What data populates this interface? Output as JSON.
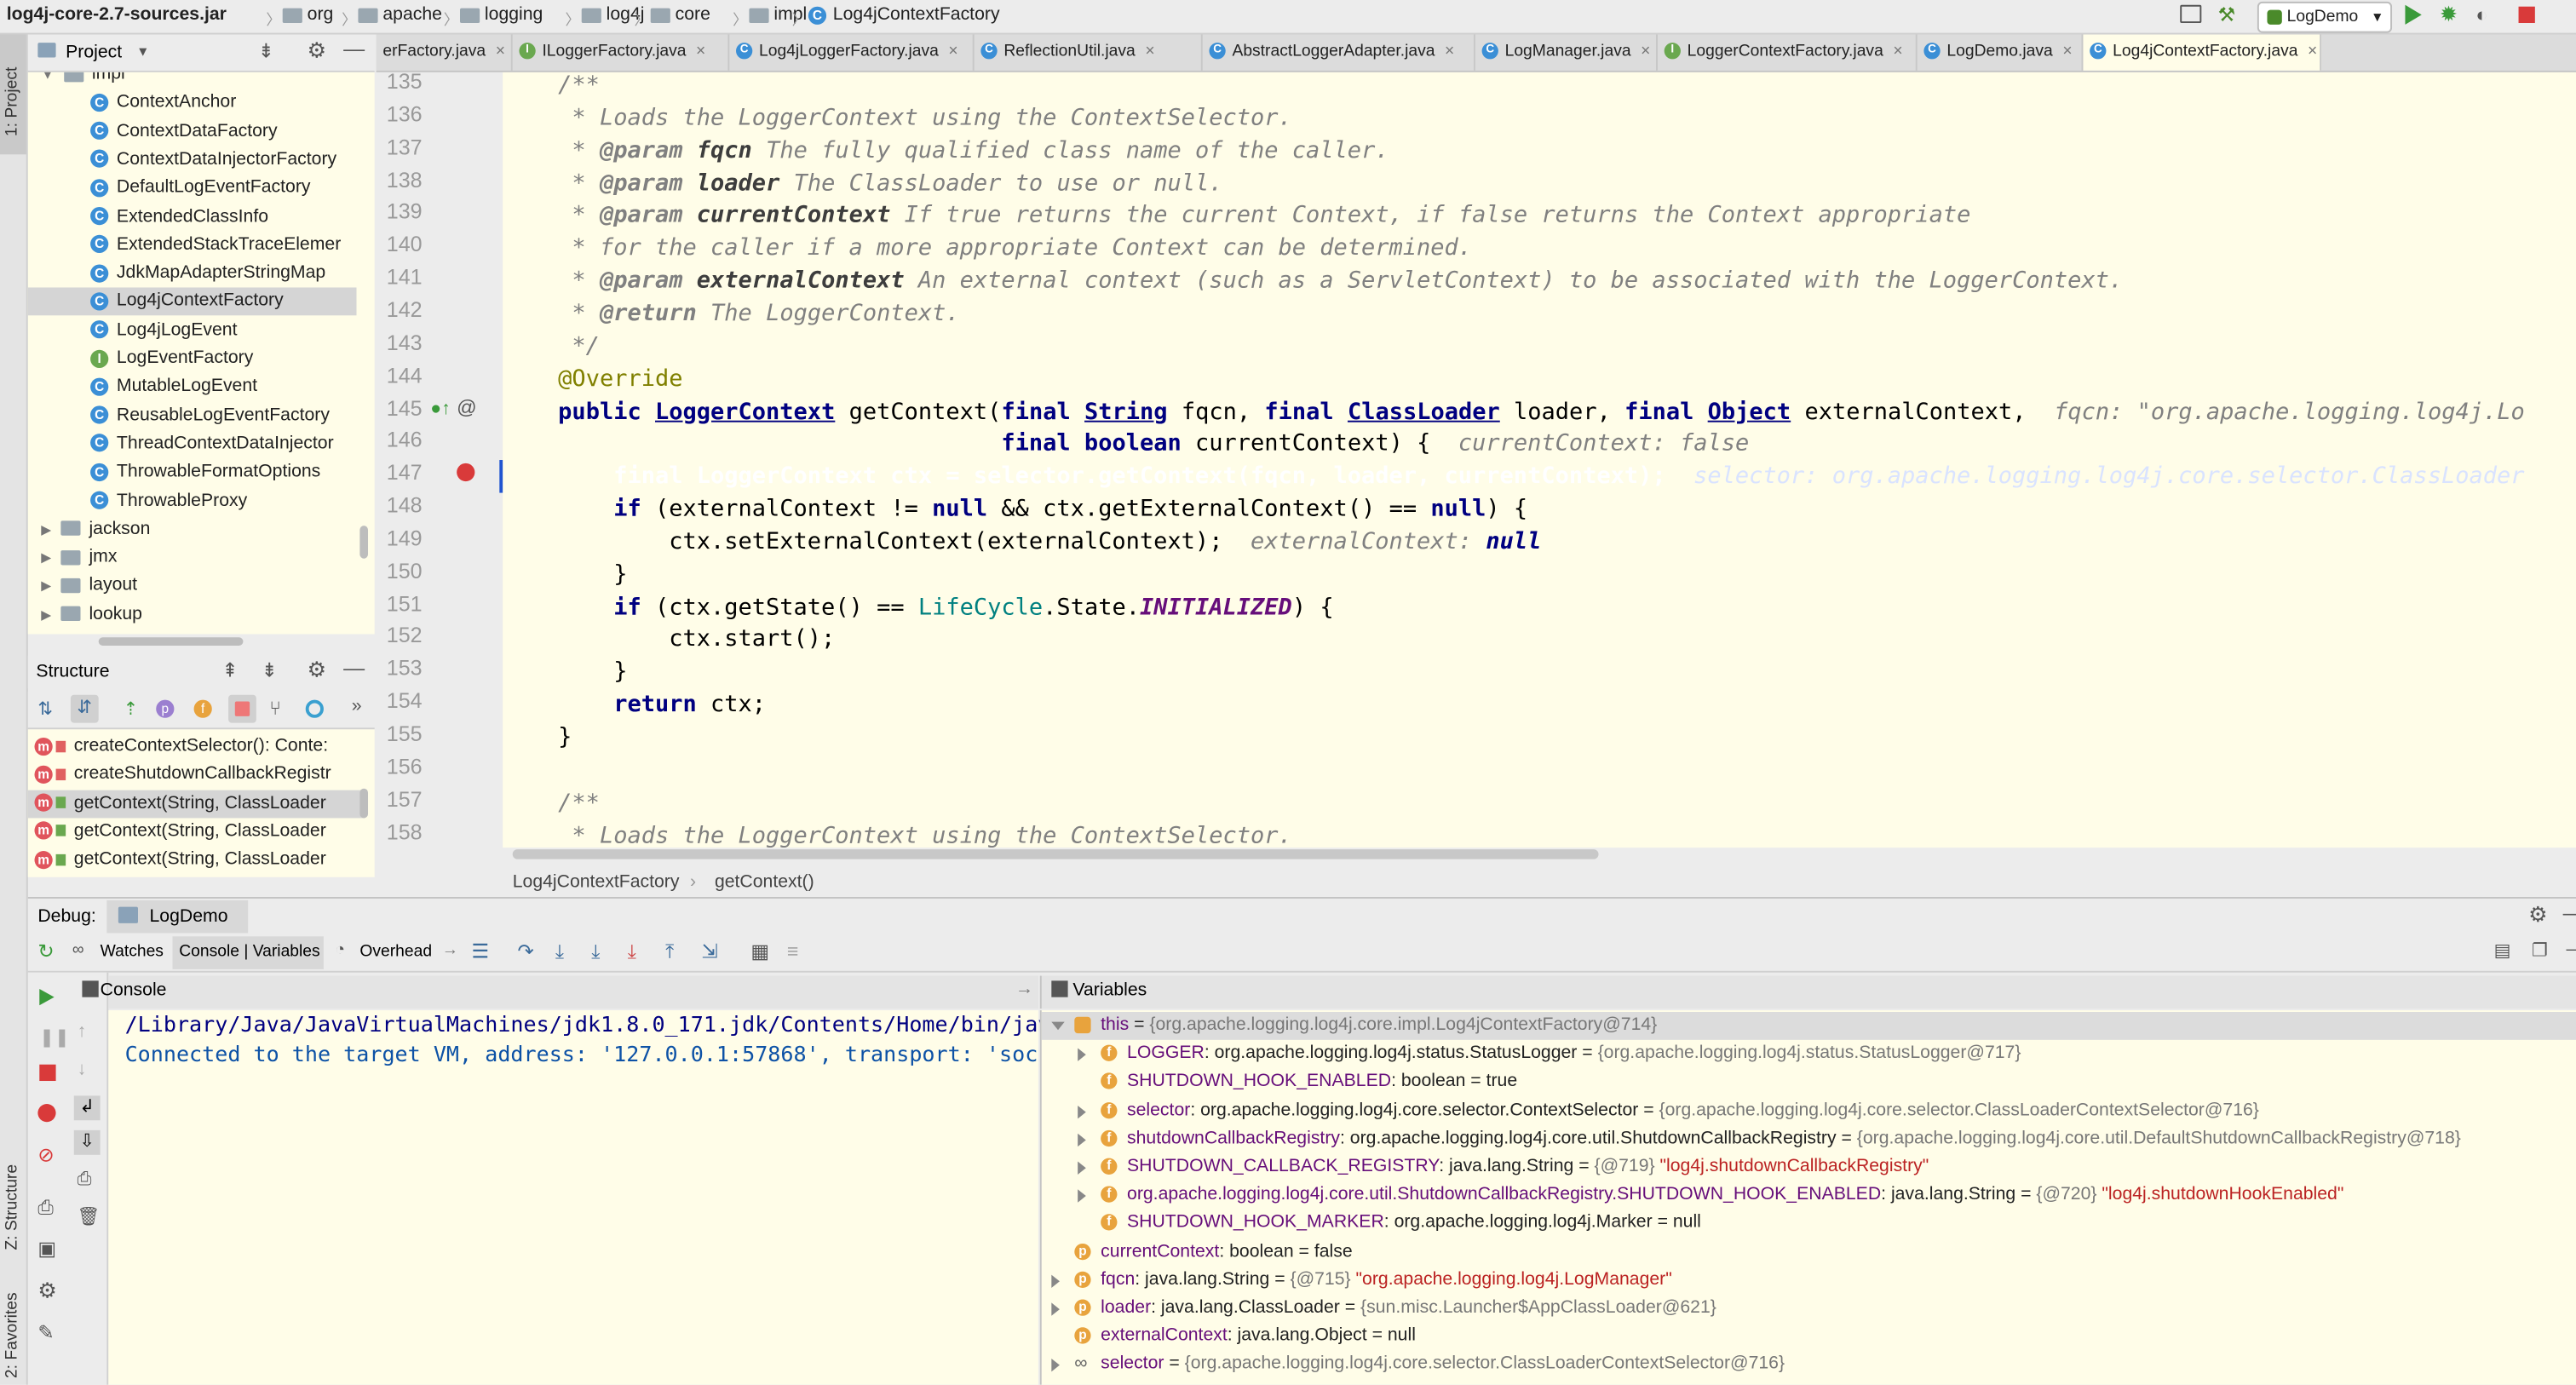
{
  "breadcrumb": [
    "log4j-core-2.7-sources.jar",
    "org",
    "apache",
    "logging",
    "log4j",
    "core",
    "impl",
    "Log4jContextFactory"
  ],
  "run_config": "LogDemo",
  "project_panel": {
    "title": "Project",
    "tree": [
      {
        "label": "impl",
        "kind": "folder",
        "indent": 1
      },
      {
        "label": "ContextAnchor",
        "kind": "class"
      },
      {
        "label": "ContextDataFactory",
        "kind": "class"
      },
      {
        "label": "ContextDataInjectorFactory",
        "kind": "class"
      },
      {
        "label": "DefaultLogEventFactory",
        "kind": "class"
      },
      {
        "label": "ExtendedClassInfo",
        "kind": "class"
      },
      {
        "label": "ExtendedStackTraceElemer",
        "kind": "class"
      },
      {
        "label": "JdkMapAdapterStringMap",
        "kind": "class"
      },
      {
        "label": "Log4jContextFactory",
        "kind": "class",
        "selected": true
      },
      {
        "label": "Log4jLogEvent",
        "kind": "class"
      },
      {
        "label": "LogEventFactory",
        "kind": "interface"
      },
      {
        "label": "MutableLogEvent",
        "kind": "class"
      },
      {
        "label": "ReusableLogEventFactory",
        "kind": "class"
      },
      {
        "label": "ThreadContextDataInjector",
        "kind": "class"
      },
      {
        "label": "ThrowableFormatOptions",
        "kind": "class"
      },
      {
        "label": "ThrowableProxy",
        "kind": "class"
      },
      {
        "label": "jackson",
        "kind": "package"
      },
      {
        "label": "jmx",
        "kind": "package"
      },
      {
        "label": "layout",
        "kind": "package"
      },
      {
        "label": "lookup",
        "kind": "package"
      }
    ]
  },
  "structure_panel": {
    "title": "Structure",
    "items": [
      {
        "label": "createContextSelector(): Conte:",
        "selected": false
      },
      {
        "label": "createShutdownCallbackRegistr",
        "selected": false
      },
      {
        "label": "getContext(String, ClassLoader",
        "selected": true
      },
      {
        "label": "getContext(String, ClassLoader",
        "selected": false
      },
      {
        "label": "getContext(String, ClassLoader",
        "selected": false
      }
    ]
  },
  "tabs": [
    {
      "label": "erFactory.java",
      "kind": "class"
    },
    {
      "label": "ILoggerFactory.java",
      "kind": "interface"
    },
    {
      "label": "Log4jLoggerFactory.java",
      "kind": "class"
    },
    {
      "label": "ReflectionUtil.java",
      "kind": "class"
    },
    {
      "label": "AbstractLoggerAdapter.java",
      "kind": "class"
    },
    {
      "label": "LogManager.java",
      "kind": "class"
    },
    {
      "label": "LoggerContextFactory.java",
      "kind": "interface"
    },
    {
      "label": "LogDemo.java",
      "kind": "class"
    },
    {
      "label": "Log4jContextFactory.java",
      "kind": "class",
      "active": true
    }
  ],
  "line_numbers": [
    "135",
    "136",
    "137",
    "138",
    "139",
    "140",
    "141",
    "142",
    "143",
    "144",
    "145",
    "146",
    "147",
    "148",
    "149",
    "150",
    "151",
    "152",
    "153",
    "154",
    "155",
    "156",
    "157",
    "158"
  ],
  "code_lines": [
    "    /**",
    "     * Loads the LoggerContext using the ContextSelector.",
    "     * @param fqcn The fully qualified class name of the caller.",
    "     * @param loader The ClassLoader to use or null.",
    "     * @param currentContext If true returns the current Context, if false returns the Context appropriate",
    "     * for the caller if a more appropriate Context can be determined.",
    "     * @param externalContext An external context (such as a ServletContext) to be associated with the LoggerContext.",
    "     * @return The LoggerContext.",
    "     */",
    "    @Override",
    "    public LoggerContext getContext(final String fqcn, final ClassLoader loader, final Object externalContext,  fqcn: \"org.apache.logging.log4j.Lo",
    "                                    final boolean currentContext) {  currentContext: false",
    "        final LoggerContext ctx = selector.getContext(fqcn, loader, currentContext);  selector: org.apache.logging.log4j.core.selector.ClassLoader",
    "        if (externalContext != null && ctx.getExternalContext() == null) {",
    "            ctx.setExternalContext(externalContext);  externalContext: null",
    "        }",
    "        if (ctx.getState() == LifeCycle.State.INITIALIZED) {",
    "            ctx.start();",
    "        }",
    "        return ctx;",
    "    }",
    "",
    "    /**",
    "     * Loads the LoggerContext using the ContextSelector."
  ],
  "editor_breadcrumb": [
    "Log4jContextFactory",
    "getContext()"
  ],
  "debug": {
    "label": "Debug:",
    "session": "LogDemo",
    "toolbar": {
      "watches": "Watches",
      "console_vars": "Console | Variables",
      "overhead": "Overhead"
    },
    "console_title": "Console",
    "console_lines": [
      "/Library/Java/JavaVirtualMachines/jdk1.8.0_171.jdk/Contents/Home/bin/java ...",
      "Connected to the target VM, address: '127.0.0.1:57868', transport: 'socket'"
    ],
    "variables_title": "Variables",
    "variables": [
      {
        "indent": 0,
        "expand": "open",
        "badge": "this",
        "name": "this",
        "type": "",
        "value": "{org.apache.logging.log4j.core.impl.Log4jContextFactory@714}",
        "str": ""
      },
      {
        "indent": 1,
        "expand": "closed",
        "badge": "f",
        "name": "LOGGER",
        "type": ": org.apache.logging.log4j.status.StatusLogger ",
        "value": "{org.apache.logging.log4j.status.StatusLogger@717}",
        "str": ""
      },
      {
        "indent": 1,
        "expand": "none",
        "badge": "f",
        "name": "SHUTDOWN_HOOK_ENABLED",
        "type": ": boolean ",
        "value": "true",
        "str": "",
        "plain": true
      },
      {
        "indent": 1,
        "expand": "closed",
        "badge": "f",
        "name": "selector",
        "type": ": org.apache.logging.log4j.core.selector.ContextSelector ",
        "value": "{org.apache.logging.log4j.core.selector.ClassLoaderContextSelector@716}",
        "str": ""
      },
      {
        "indent": 1,
        "expand": "closed",
        "badge": "f",
        "name": "shutdownCallbackRegistry",
        "type": ": org.apache.logging.log4j.core.util.ShutdownCallbackRegistry ",
        "value": "{org.apache.logging.log4j.core.util.DefaultShutdownCallbackRegistry@718}",
        "str": ""
      },
      {
        "indent": 1,
        "expand": "closed",
        "badge": "f",
        "name": "SHUTDOWN_CALLBACK_REGISTRY",
        "type": ": java.lang.String ",
        "value": "{@719} ",
        "str": "\"log4j.shutdownCallbackRegistry\""
      },
      {
        "indent": 1,
        "expand": "closed",
        "badge": "f",
        "name": "org.apache.logging.log4j.core.util.ShutdownCallbackRegistry.SHUTDOWN_HOOK_ENABLED",
        "type": ": java.lang.String ",
        "value": "{@720} ",
        "str": "\"log4j.shutdownHookEnabled\""
      },
      {
        "indent": 1,
        "expand": "none",
        "badge": "f",
        "name": "SHUTDOWN_HOOK_MARKER",
        "type": ": org.apache.logging.log4j.Marker ",
        "value": "null",
        "str": "",
        "plain": true
      },
      {
        "indent": 0,
        "expand": "none",
        "badge": "p",
        "name": "currentContext",
        "type": ": boolean ",
        "value": "false",
        "str": "",
        "plain": true
      },
      {
        "indent": 0,
        "expand": "closed",
        "badge": "p",
        "name": "fqcn",
        "type": ": java.lang.String ",
        "value": "{@715} ",
        "str": "\"org.apache.logging.log4j.LogManager\""
      },
      {
        "indent": 0,
        "expand": "closed",
        "badge": "p",
        "name": "loader",
        "type": ": java.lang.ClassLoader ",
        "value": "{sun.misc.Launcher$AppClassLoader@621}",
        "str": ""
      },
      {
        "indent": 0,
        "expand": "none",
        "badge": "p",
        "name": "externalContext",
        "type": ": java.lang.Object ",
        "value": "null",
        "str": "",
        "plain": true
      },
      {
        "indent": 0,
        "expand": "closed",
        "badge": "oo",
        "name": "selector",
        "type": " ",
        "value": "{org.apache.logging.log4j.core.selector.ClassLoaderContextSelector@716}",
        "str": ""
      }
    ]
  },
  "side_labels": {
    "project": "1: Project",
    "structure": "Z: Structure",
    "favorites": "2: Favorites"
  },
  "colors": {
    "editor_bg": "#fffde8",
    "highlight": "#2155d0",
    "class_icon": "#3b8fd6",
    "interface_icon": "#6aa84f",
    "method_icon": "#e0545c",
    "field_icon": "#e8a33d"
  }
}
